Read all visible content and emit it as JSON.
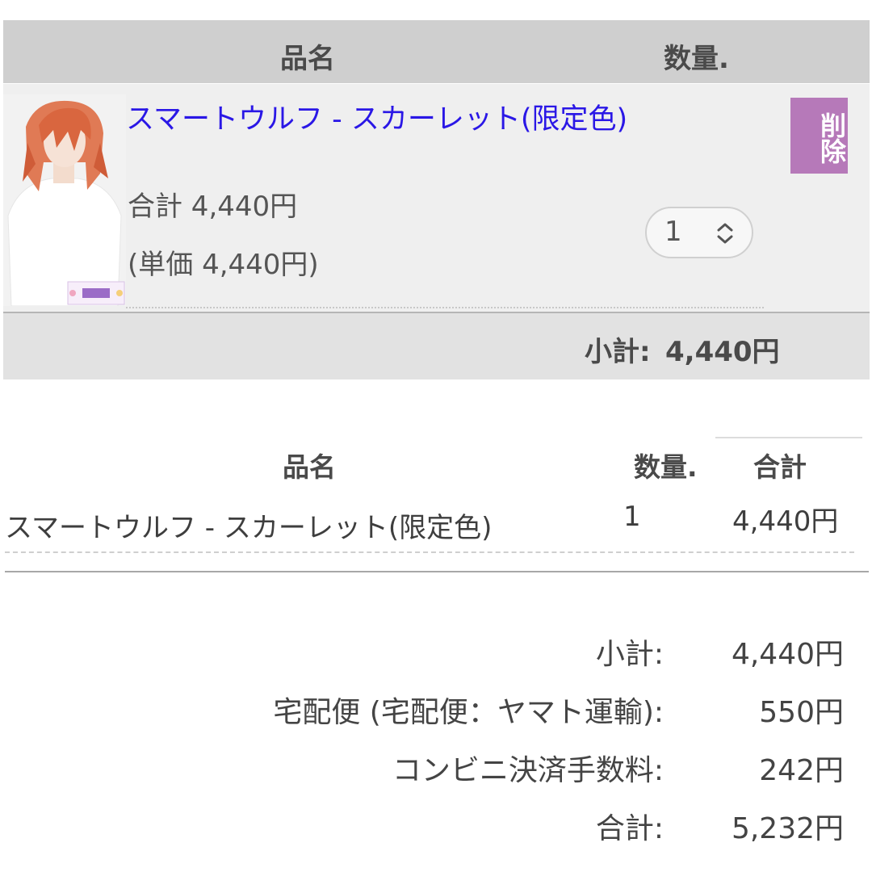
{
  "cart": {
    "header": {
      "name_col": "品名",
      "qty_col": "数量."
    },
    "item": {
      "thumbnail_icon": "wig-product-photo",
      "title": "スマートウルフ - スカーレット(限定色)",
      "line_total": "合計 4,440円",
      "unit_price": "(単価 4,440円)",
      "quantity": "1",
      "delete_label": "削除"
    },
    "subtotal_label": "小計:",
    "subtotal_value": "4,440円"
  },
  "summary": {
    "headers": {
      "name": "品名",
      "qty": "数量.",
      "total": "合計"
    },
    "item": {
      "name": "スマートウルフ - スカーレット(限定色)",
      "qty": "1",
      "amount": "4,440円"
    }
  },
  "totals": [
    {
      "label": "小計:",
      "value": "4,440円"
    },
    {
      "label": "宅配便 (宅配便：ヤマト運輸):",
      "value": "550円"
    },
    {
      "label": "コンビニ決済手数料:",
      "value": "242円"
    },
    {
      "label": "合計:",
      "value": "5,232円"
    }
  ],
  "colors": {
    "link": "#2a17e6",
    "delete_button": "#b679b9",
    "header_bg": "#cfcfcf"
  }
}
